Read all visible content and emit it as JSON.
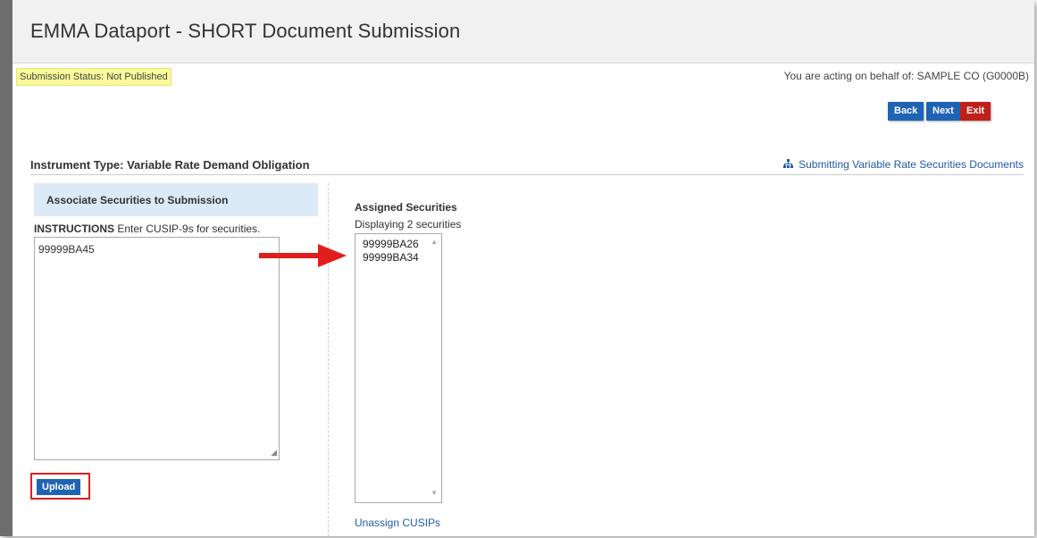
{
  "header": {
    "title": "EMMA Dataport - SHORT Document Submission"
  },
  "status": {
    "text": "Submission Status: Not Published"
  },
  "behalf": {
    "text": "You are acting on behalf of: SAMPLE CO (G0000B)"
  },
  "nav_buttons": {
    "back": "Back",
    "next": "Next",
    "exit": "Exit"
  },
  "instrument": {
    "label": "Instrument Type: Variable Rate Demand Obligation"
  },
  "doc_link": {
    "icon": "sitemap-icon",
    "text": "Submitting Variable Rate Securities Documents"
  },
  "associate": {
    "heading": "Associate Securities to Submission",
    "instructions_bold": "INSTRUCTIONS",
    "instructions_text": "Enter CUSIP-9s for securities.",
    "input_value": "99999BA45",
    "upload_label": "Upload"
  },
  "assigned": {
    "title": "Assigned Securities",
    "count": "Displaying 2 securities",
    "items": [
      "99999BA26",
      "99999BA34"
    ],
    "unassign_label": "Unassign CUSIPs"
  },
  "colors": {
    "primary_button": "#1f64b4",
    "exit_button": "#c0201a",
    "highlight": "#e01e1e",
    "status_bg": "#fafa9a"
  }
}
